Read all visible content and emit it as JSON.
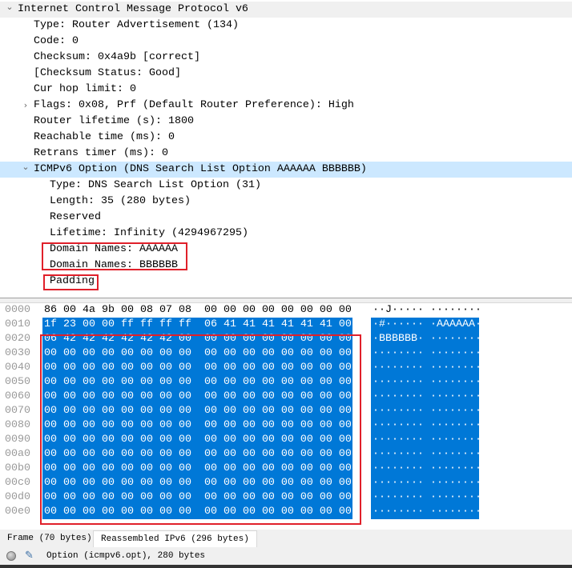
{
  "tree": [
    {
      "text": "Internet Control Message Protocol v6",
      "level": 0,
      "expander": "expanded",
      "selected": false
    },
    {
      "text": "Type: Router Advertisement (134)",
      "level": 1,
      "expander": "",
      "selected": false
    },
    {
      "text": "Code: 0",
      "level": 1,
      "expander": "",
      "selected": false
    },
    {
      "text": "Checksum: 0x4a9b [correct]",
      "level": 1,
      "expander": "",
      "selected": false
    },
    {
      "text": "[Checksum Status: Good]",
      "level": 1,
      "expander": "",
      "selected": false
    },
    {
      "text": "Cur hop limit: 0",
      "level": 1,
      "expander": "",
      "selected": false
    },
    {
      "text": "Flags: 0x08, Prf (Default Router Preference): High",
      "level": 1,
      "expander": "collapsed",
      "selected": false
    },
    {
      "text": "Router lifetime (s): 1800",
      "level": 1,
      "expander": "",
      "selected": false
    },
    {
      "text": "Reachable time (ms): 0",
      "level": 1,
      "expander": "",
      "selected": false
    },
    {
      "text": "Retrans timer (ms): 0",
      "level": 1,
      "expander": "",
      "selected": false
    },
    {
      "text": "ICMPv6 Option (DNS Search List Option AAAAAA BBBBBB)",
      "level": 1,
      "expander": "expanded",
      "selected": true
    },
    {
      "text": "Type: DNS Search List Option (31)",
      "level": 2,
      "expander": "",
      "selected": false
    },
    {
      "text": "Length: 35 (280 bytes)",
      "level": 2,
      "expander": "",
      "selected": false
    },
    {
      "text": "Reserved",
      "level": 2,
      "expander": "",
      "selected": false
    },
    {
      "text": "Lifetime: Infinity (4294967295)",
      "level": 2,
      "expander": "",
      "selected": false
    },
    {
      "text": "Domain Names: AAAAAA",
      "level": 2,
      "expander": "",
      "selected": false
    },
    {
      "text": "Domain Names: BBBBBB",
      "level": 2,
      "expander": "",
      "selected": false
    },
    {
      "text": "Padding",
      "level": 2,
      "expander": "",
      "selected": false
    }
  ],
  "hex": [
    {
      "offset": "0000",
      "bytes": "86 00 4a 9b 00 08 07 08  00 00 00 00 00 00 00 00",
      "ascii": "··J····· ········",
      "selected": false
    },
    {
      "offset": "0010",
      "bytes": "1f 23 00 00 ff ff ff ff  06 41 41 41 41 41 41 00",
      "ascii": "·#······ ·AAAAAA·",
      "selected": true
    },
    {
      "offset": "0020",
      "bytes": "06 42 42 42 42 42 42 00  00 00 00 00 00 00 00 00",
      "ascii": "·BBBBBB· ········",
      "selected": true
    },
    {
      "offset": "0030",
      "bytes": "00 00 00 00 00 00 00 00  00 00 00 00 00 00 00 00",
      "ascii": "········ ········",
      "selected": true
    },
    {
      "offset": "0040",
      "bytes": "00 00 00 00 00 00 00 00  00 00 00 00 00 00 00 00",
      "ascii": "········ ········",
      "selected": true
    },
    {
      "offset": "0050",
      "bytes": "00 00 00 00 00 00 00 00  00 00 00 00 00 00 00 00",
      "ascii": "········ ········",
      "selected": true
    },
    {
      "offset": "0060",
      "bytes": "00 00 00 00 00 00 00 00  00 00 00 00 00 00 00 00",
      "ascii": "········ ········",
      "selected": true
    },
    {
      "offset": "0070",
      "bytes": "00 00 00 00 00 00 00 00  00 00 00 00 00 00 00 00",
      "ascii": "········ ········",
      "selected": true
    },
    {
      "offset": "0080",
      "bytes": "00 00 00 00 00 00 00 00  00 00 00 00 00 00 00 00",
      "ascii": "········ ········",
      "selected": true
    },
    {
      "offset": "0090",
      "bytes": "00 00 00 00 00 00 00 00  00 00 00 00 00 00 00 00",
      "ascii": "········ ········",
      "selected": true
    },
    {
      "offset": "00a0",
      "bytes": "00 00 00 00 00 00 00 00  00 00 00 00 00 00 00 00",
      "ascii": "········ ········",
      "selected": true
    },
    {
      "offset": "00b0",
      "bytes": "00 00 00 00 00 00 00 00  00 00 00 00 00 00 00 00",
      "ascii": "········ ········",
      "selected": true
    },
    {
      "offset": "00c0",
      "bytes": "00 00 00 00 00 00 00 00  00 00 00 00 00 00 00 00",
      "ascii": "········ ········",
      "selected": true
    },
    {
      "offset": "00d0",
      "bytes": "00 00 00 00 00 00 00 00  00 00 00 00 00 00 00 00",
      "ascii": "········ ········",
      "selected": true
    },
    {
      "offset": "00e0",
      "bytes": "00 00 00 00 00 00 00 00  00 00 00 00 00 00 00 00",
      "ascii": "········ ········",
      "selected": true
    }
  ],
  "tabs": [
    {
      "label": "Frame (70 bytes)",
      "active": false
    },
    {
      "label": "Reassembled IPv6 (296 bytes)",
      "active": true
    }
  ],
  "status": {
    "text": "Option (icmpv6.opt), 280 bytes"
  },
  "colors": {
    "selection": "#0078d7",
    "tree_selection": "#cce8ff",
    "annotation": "#e0202a"
  }
}
